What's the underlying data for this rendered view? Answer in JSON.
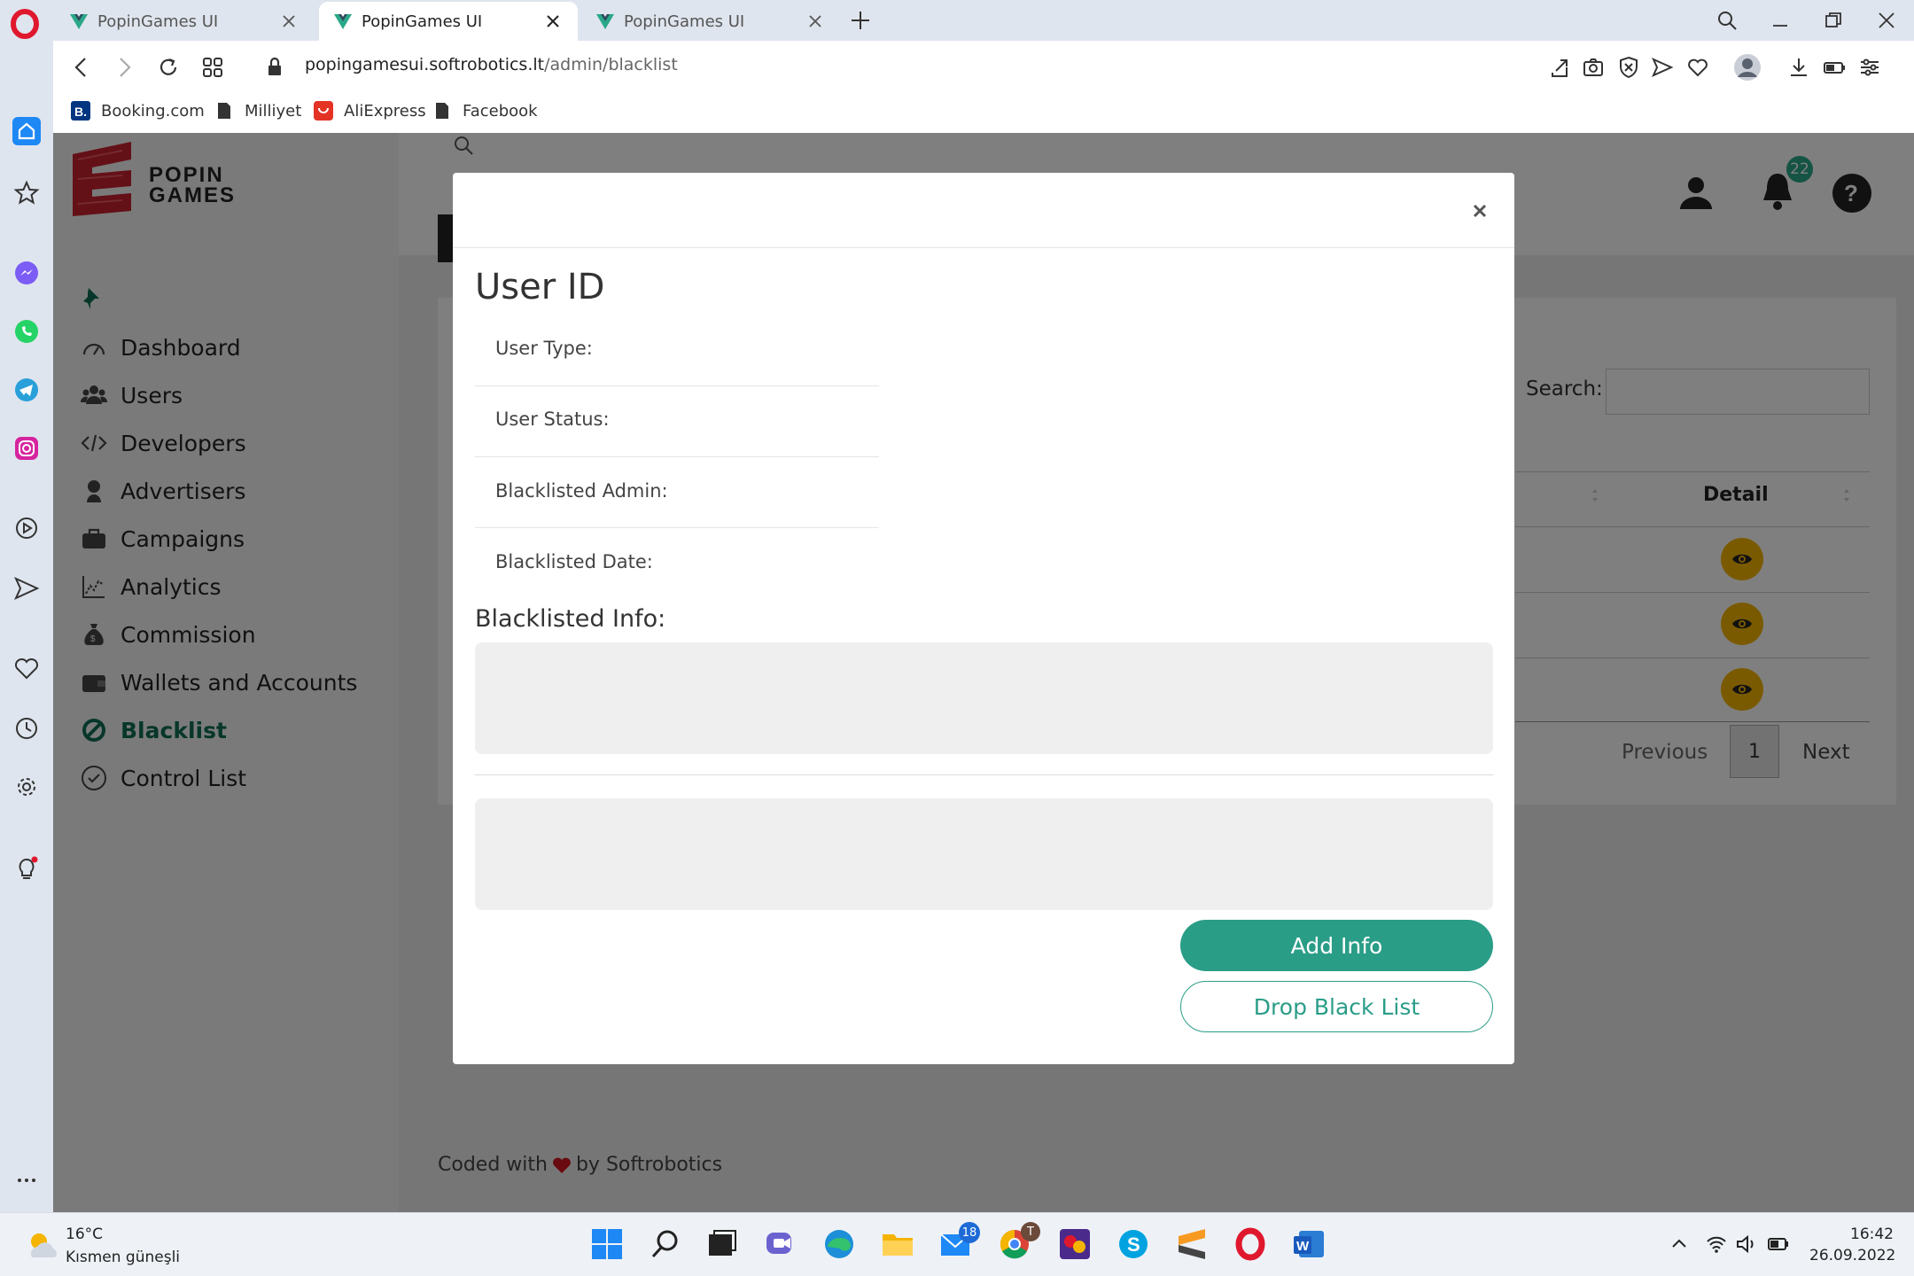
{
  "browser": {
    "tabs": [
      {
        "title": "PopinGames UI",
        "active": false
      },
      {
        "title": "PopinGames UI",
        "active": true
      },
      {
        "title": "PopinGames UI",
        "active": false
      }
    ],
    "url_domain": "popingamesui.softrobotics.lt",
    "url_path": "/admin/blacklist",
    "bookmarks": [
      "Booking.com",
      "Milliyet",
      "AliExpress",
      "Facebook"
    ]
  },
  "app": {
    "logo_text": "POPIN GAMES",
    "nav": [
      {
        "label": "Dashboard",
        "icon": "gauge-icon"
      },
      {
        "label": "Users",
        "icon": "users-icon"
      },
      {
        "label": "Developers",
        "icon": "code-icon"
      },
      {
        "label": "Advertisers",
        "icon": "advertiser-icon"
      },
      {
        "label": "Campaigns",
        "icon": "briefcase-icon"
      },
      {
        "label": "Analytics",
        "icon": "chart-icon"
      },
      {
        "label": "Commission",
        "icon": "moneybag-icon"
      },
      {
        "label": "Wallets and Accounts",
        "icon": "wallet-icon"
      },
      {
        "label": "Blacklist",
        "icon": "ban-icon",
        "active": true
      },
      {
        "label": "Control List",
        "icon": "check-circle-icon"
      }
    ],
    "notification_count": "22",
    "search_label": "Search:",
    "table": {
      "detail_header": "Detail",
      "row_count": 3
    },
    "pagination": {
      "previous": "Previous",
      "current": "1",
      "next": "Next"
    },
    "footer": {
      "before": "Coded with",
      "after": "by Softrobotics"
    }
  },
  "modal": {
    "title": "User ID",
    "fields": [
      "User Type:",
      "User Status:",
      "Blacklisted Admin:",
      "Blacklisted Date:"
    ],
    "info_heading": "Blacklisted Info:",
    "add_button": "Add Info",
    "drop_button": "Drop Black List"
  },
  "taskbar": {
    "weather_temp": "16°C",
    "weather_desc": "Kısmen güneşli",
    "mail_badge": "18",
    "chrome_badge": "T",
    "time": "16:42",
    "date": "26.09.2022"
  },
  "colors": {
    "accent": "#2a9d87",
    "active_nav": "#0e6e55",
    "eye_button": "#f5b400",
    "logo_red": "#c8202f",
    "badge": "#2aa889"
  }
}
